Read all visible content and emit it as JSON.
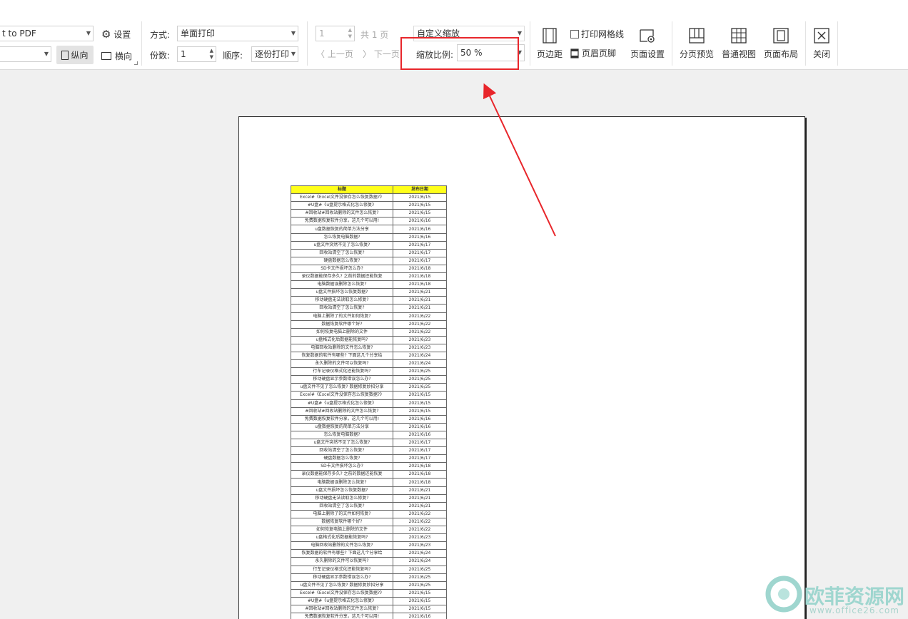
{
  "toolbar": {
    "printer_value": "t to PDF",
    "paper_value": "",
    "settings_label": "设置",
    "portrait_label": "纵向",
    "landscape_label": "横向",
    "mode_label": "方式:",
    "mode_value": "单面打印",
    "copies_label": "份数:",
    "copies_value": "1",
    "order_label": "顺序:",
    "order_value": "逐份打印",
    "page_value": "1",
    "total_pages": "共 1 页",
    "prev_page": "上一页",
    "next_page": "下一页",
    "zoom_mode_value": "自定义缩放",
    "zoom_ratio_label": "缩放比例:",
    "zoom_ratio_value": "50 %",
    "print_gridlines_label": "打印网格线",
    "margins_label": "页边距",
    "header_footer_label": "页眉页脚",
    "page_setup_label": "页面设置",
    "page_break_preview_label": "分页预览",
    "normal_view_label": "普通视图",
    "page_layout_label": "页面布局",
    "close_label": "关闭"
  },
  "sheet": {
    "headers": [
      "标题",
      "发布日期"
    ],
    "rows": [
      [
        "Excel#《Excel文件没保存怎么恢复数据?》",
        "2021/6/15"
      ],
      [
        "#U盘#《u盘提示格式化怎么修复》",
        "2021/6/15"
      ],
      [
        "#回收站#回收站删除的文件怎么恢复?",
        "2021/6/15"
      ],
      [
        "免费数据恢复软件分享，这几个可以用!",
        "2021/6/16"
      ],
      [
        "u盘数据恢复的简单方法分享",
        "2021/6/16"
      ],
      [
        "怎么恢复电脑数据?",
        "2021/6/16"
      ],
      [
        "u盘文件突然不见了怎么恢复?",
        "2021/6/17"
      ],
      [
        "回收站清空了怎么恢复?",
        "2021/6/17"
      ],
      [
        "硬盘数据怎么恢复?",
        "2021/6/17"
      ],
      [
        "SD卡文件损坏怎么办?",
        "2021/6/18"
      ],
      [
        "录仪数据能保存多久? 之前的数据还能恢复",
        "2021/6/18"
      ],
      [
        "电脑数据误删除怎么恢复?",
        "2021/6/18"
      ],
      [
        "u盘文件损坏怎么恢复数据?",
        "2021/6/21"
      ],
      [
        "移动硬盘无法读取怎么修复?",
        "2021/6/21"
      ],
      [
        "回收站清空了怎么恢复?",
        "2021/6/21"
      ],
      [
        "电脑上删除了的文件如何恢复?",
        "2021/6/22"
      ],
      [
        "数据恢复软件哪个好?",
        "2021/6/22"
      ],
      [
        "如何恢复电脑上删除的文件",
        "2021/6/22"
      ],
      [
        "u盘格式化后数据能恢复吗?",
        "2021/6/23"
      ],
      [
        "电脑回收站删除的文件怎么恢复?",
        "2021/6/23"
      ],
      [
        "恢复数据的软件有哪些? 下面这几个分享给",
        "2021/6/24"
      ],
      [
        "永久删除的文件可以恢复吗?",
        "2021/6/24"
      ],
      [
        "行车记录仪格式化还能恢复吗?",
        "2021/6/25"
      ],
      [
        "移动硬盘显示参数错误怎么办?",
        "2021/6/25"
      ],
      [
        "u盘文件不见了怎么恢复? 数据修复妙招分享",
        "2021/6/25"
      ],
      [
        "Excel#《Excel文件没保存怎么恢复数据?》",
        "2021/6/15"
      ],
      [
        "#U盘#《u盘提示格式化怎么修复》",
        "2021/6/15"
      ],
      [
        "#回收站#回收站删除的文件怎么恢复?",
        "2021/6/15"
      ],
      [
        "免费数据恢复软件分享，这几个可以用!",
        "2021/6/16"
      ],
      [
        "u盘数据恢复的简单方法分享",
        "2021/6/16"
      ],
      [
        "怎么恢复电脑数据?",
        "2021/6/16"
      ],
      [
        "u盘文件突然不见了怎么恢复?",
        "2021/6/17"
      ],
      [
        "回收站清空了怎么恢复?",
        "2021/6/17"
      ],
      [
        "硬盘数据怎么恢复?",
        "2021/6/17"
      ],
      [
        "SD卡文件损坏怎么办?",
        "2021/6/18"
      ],
      [
        "录仪数据能保存多久? 之前的数据还能恢复",
        "2021/6/18"
      ],
      [
        "电脑数据误删除怎么恢复?",
        "2021/6/18"
      ],
      [
        "u盘文件损坏怎么恢复数据?",
        "2021/6/21"
      ],
      [
        "移动硬盘无法读取怎么修复?",
        "2021/6/21"
      ],
      [
        "回收站清空了怎么恢复?",
        "2021/6/21"
      ],
      [
        "电脑上删除了的文件如何恢复?",
        "2021/6/22"
      ],
      [
        "数据恢复软件哪个好?",
        "2021/6/22"
      ],
      [
        "如何恢复电脑上删除的文件",
        "2021/6/22"
      ],
      [
        "u盘格式化后数据能恢复吗?",
        "2021/6/23"
      ],
      [
        "电脑回收站删除的文件怎么恢复?",
        "2021/6/23"
      ],
      [
        "恢复数据的软件有哪些? 下面这几个分享给",
        "2021/6/24"
      ],
      [
        "永久删除的文件可以恢复吗?",
        "2021/6/24"
      ],
      [
        "行车记录仪格式化还能恢复吗?",
        "2021/6/25"
      ],
      [
        "移动硬盘显示参数错误怎么办?",
        "2021/6/25"
      ],
      [
        "u盘文件不见了怎么恢复? 数据修复妙招分享",
        "2021/6/25"
      ],
      [
        "Excel#《Excel文件没保存怎么恢复数据?》",
        "2021/6/15"
      ],
      [
        "#U盘#《u盘提示格式化怎么修复》",
        "2021/6/15"
      ],
      [
        "#回收站#回收站删除的文件怎么恢复?",
        "2021/6/15"
      ],
      [
        "免费数据恢复软件分享，这几个可以用!",
        "2021/6/16"
      ]
    ]
  },
  "watermark": {
    "text": "欧菲资源网",
    "url": "www.office26.com"
  },
  "colors": {
    "highlight": "#e8262b",
    "header_fill": "#ffff1a"
  }
}
